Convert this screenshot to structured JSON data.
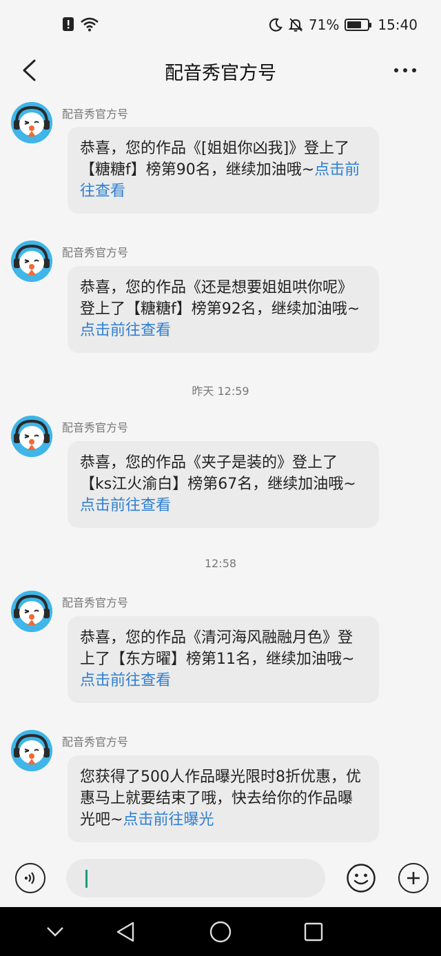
{
  "status_bar": {
    "battery_percent": "71%",
    "battery_level": 0.71,
    "time": "15:40",
    "icons": [
      "alert-icon",
      "wifi-icon",
      "moon-icon",
      "mute-bell-icon",
      "battery-icon"
    ]
  },
  "header": {
    "title": "配音秀官方号",
    "back_icon": "chevron-left-icon",
    "more_icon": "more-horizontal-icon"
  },
  "messages": [
    {
      "sender": "配音秀官方号",
      "text": "恭喜，您的作品《[姐姐你凶我]》登上了【糖糖f】榜第90名，继续加油哦~",
      "link": "点击前往查看"
    },
    {
      "sender": "配音秀官方号",
      "text": "恭喜，您的作品《还是想要姐姐哄你呢》登上了【糖糖f】榜第92名，继续加油哦~",
      "link": "点击前往查看"
    },
    {
      "time_separator": "昨天 12:59",
      "sender": "配音秀官方号",
      "text": "恭喜，您的作品《夹子是装的》登上了【ks江火渝白】榜第67名，继续加油哦~",
      "link": "点击前往查看"
    },
    {
      "time_separator": "12:58",
      "sender": "配音秀官方号",
      "text": "恭喜，您的作品《清河海风融融月色》登上了【东方曜】榜第11名，继续加油哦~",
      "link": "点击前往查看"
    },
    {
      "sender": "配音秀官方号",
      "text": "您获得了500人作品曝光限时8折优惠，优惠马上就要结束了哦，快去给你的作品曝光吧~",
      "link": "点击前往曝光"
    }
  ],
  "input_bar": {
    "voice_icon": "voice-icon",
    "placeholder": "",
    "emoji_icon": "emoji-icon",
    "plus_icon": "plus-icon"
  },
  "nav_bar": {
    "icons": [
      "chevron-down-icon",
      "back-triangle-icon",
      "home-circle-icon",
      "recents-square-icon"
    ]
  },
  "colors": {
    "link": "#2f7fd1",
    "bubble": "#ebebeb",
    "background": "#f5f5f5",
    "avatar": "#3fb5e8",
    "caret": "#1a9b7c"
  }
}
